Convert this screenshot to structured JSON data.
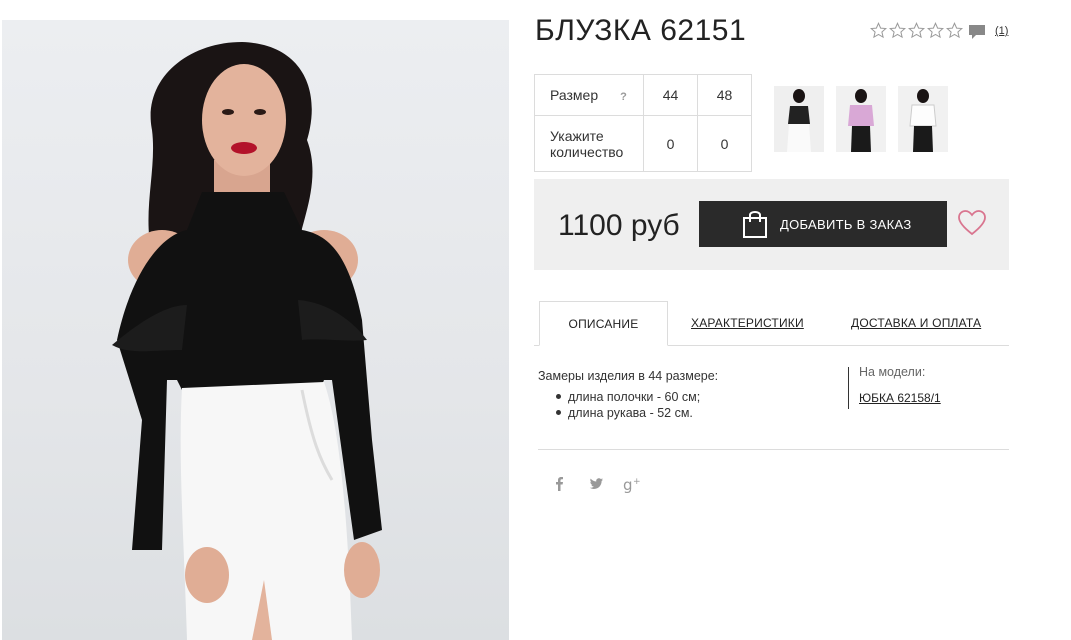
{
  "product": {
    "title": "БЛУЗКА 62151",
    "rating_stars": 5,
    "rating_value": 0,
    "comments_count": "(1)",
    "main_image": "woman-black-blouse-white-skirt"
  },
  "sizes": {
    "size_label": "Размер",
    "help_mark": "?",
    "qty_label_line1": "Укажите",
    "qty_label_line2": "количество",
    "columns": [
      {
        "size": "44",
        "qty": "0"
      },
      {
        "size": "48",
        "qty": "0"
      }
    ]
  },
  "thumbnails": [
    {
      "name": "thumb-white-skirt"
    },
    {
      "name": "thumb-pink-blouse"
    },
    {
      "name": "thumb-white-blouse"
    }
  ],
  "purchase": {
    "price": "1100 руб",
    "add_to_order": "ДОБАВИТЬ В ЗАКАЗ",
    "bag_icon": "shopping-bag-icon",
    "wishlist_icon": "heart-icon"
  },
  "tabs": [
    {
      "label": "ОПИСАНИЕ",
      "active": true
    },
    {
      "label": "ХАРАКТЕРИСТИКИ",
      "active": false
    },
    {
      "label": "ДОСТАВКА И ОПЛАТА",
      "active": false
    }
  ],
  "description": {
    "title": "Замеры изделия в 44 размере:",
    "items": [
      "длина полочки - 60 см;",
      "длина рукава - 52 см."
    ],
    "model_label": "На модели:",
    "model_link": "ЮБКА 62158/1"
  },
  "social": [
    "facebook-icon",
    "twitter-icon",
    "google-plus-icon"
  ],
  "colors": {
    "button_bg": "#2a2a2a",
    "price_box_bg": "#efefef",
    "heart": "#d9758f",
    "star_outline": "#9a9a9a"
  }
}
